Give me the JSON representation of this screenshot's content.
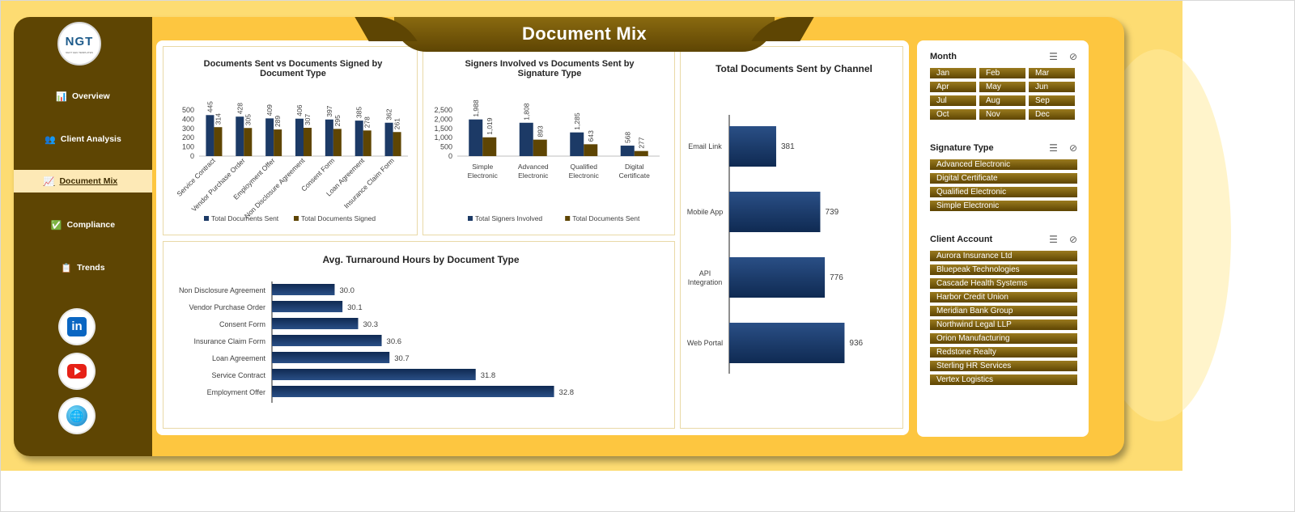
{
  "header": {
    "title": "Document Mix"
  },
  "logo": {
    "text": "NGT",
    "tagline": "NEXT GEN TEMPLATES"
  },
  "sidebar": {
    "items": [
      {
        "label": "Overview",
        "icon": "bar-chart-icon",
        "glyph": "📊"
      },
      {
        "label": "Client Analysis",
        "icon": "people-icon",
        "glyph": "👥"
      },
      {
        "label": "Document Mix",
        "icon": "line-chart-icon",
        "glyph": "📈",
        "active": true
      },
      {
        "label": "Compliance",
        "icon": "checkmark-icon",
        "glyph": "✅"
      },
      {
        "label": "Trends",
        "icon": "document-icon",
        "glyph": "📋"
      }
    ],
    "social": [
      {
        "name": "linkedin-icon",
        "glyph": "in"
      },
      {
        "name": "youtube-icon",
        "glyph": ""
      },
      {
        "name": "website-icon",
        "glyph": "🌐"
      }
    ]
  },
  "slicers": {
    "month": {
      "title": "Month",
      "options": [
        "Jan",
        "Feb",
        "Mar",
        "Apr",
        "May",
        "Jun",
        "Jul",
        "Aug",
        "Sep",
        "Oct",
        "Nov",
        "Dec"
      ]
    },
    "signature_type": {
      "title": "Signature Type",
      "options": [
        "Advanced Electronic",
        "Digital Certificate",
        "Qualified Electronic",
        "Simple Electronic"
      ]
    },
    "client_account": {
      "title": "Client Account",
      "options": [
        "Aurora Insurance Ltd",
        "Bluepeak Technologies",
        "Cascade Health Systems",
        "Harbor Credit Union",
        "Meridian Bank Group",
        "Northwind Legal LLP",
        "Orion Manufacturing",
        "Redstone Realty",
        "Sterling HR Services",
        "Vertex Logistics"
      ]
    }
  },
  "colors": {
    "navy": "#1c3a66",
    "brown": "#5e4503",
    "sidebar": "#5e4503",
    "frame": "#fdc640"
  },
  "chart_data": [
    {
      "id": "sent-vs-signed",
      "type": "bar",
      "title": "Documents Sent vs Documents Signed by Document Type",
      "categories": [
        "Service Contract",
        "Vendor Purchase Order",
        "Employment Offer",
        "Non Disclosure Agreement",
        "Consent Form",
        "Loan Agreement",
        "Insurance Claim Form"
      ],
      "series": [
        {
          "name": "Total Documents Sent",
          "values": [
            445,
            428,
            409,
            406,
            397,
            385,
            362
          ]
        },
        {
          "name": "Total Documents Signed",
          "values": [
            314,
            305,
            289,
            307,
            295,
            278,
            261
          ]
        }
      ],
      "ylim": [
        0,
        500
      ],
      "yticks": [
        "0",
        "100",
        "200",
        "300",
        "400",
        "500"
      ],
      "legend": "bottom",
      "grid": false
    },
    {
      "id": "signers-vs-sent",
      "type": "bar",
      "title": "Signers Involved vs Documents Sent by Signature Type",
      "categories": [
        [
          "Simple",
          "Electronic"
        ],
        [
          "Advanced",
          "Electronic"
        ],
        [
          "Qualified",
          "Electronic"
        ],
        [
          "Digital",
          "Certificate"
        ]
      ],
      "series": [
        {
          "name": "Total Signers Involved",
          "values": [
            1988,
            1808,
            1285,
            568
          ],
          "labels": [
            "1,988",
            "1,808",
            "1,285",
            "568"
          ]
        },
        {
          "name": "Total Documents Sent",
          "values": [
            1019,
            893,
            643,
            277
          ],
          "labels": [
            "1,019",
            "893",
            "643",
            "277"
          ]
        }
      ],
      "ylim": [
        0,
        2500
      ],
      "yticks": [
        "0",
        "500",
        "1,000",
        "1,500",
        "2,000",
        "2,500"
      ],
      "legend": "bottom",
      "grid": false
    },
    {
      "id": "turnaround",
      "type": "bar",
      "orientation": "horizontal",
      "title": "Avg. Turnaround Hours by Document Type",
      "categories": [
        "Non Disclosure Agreement",
        "Vendor Purchase Order",
        "Consent Form",
        "Insurance Claim Form",
        "Loan Agreement",
        "Service Contract",
        "Employment Offer"
      ],
      "values": [
        30.0,
        30.1,
        30.3,
        30.6,
        30.7,
        31.8,
        32.8
      ],
      "labels": [
        "30.0",
        "30.1",
        "30.3",
        "30.6",
        "30.7",
        "31.8",
        "32.8"
      ],
      "xlim": [
        29.2,
        33.6
      ],
      "grid": false
    },
    {
      "id": "by-channel",
      "type": "bar",
      "orientation": "horizontal",
      "title": "Total Documents Sent by Channel",
      "categories": [
        [
          "Email Link"
        ],
        [
          "Mobile App"
        ],
        [
          "API",
          "Integration"
        ],
        [
          "Web Portal"
        ]
      ],
      "values": [
        381,
        739,
        776,
        936
      ],
      "labels": [
        "381",
        "739",
        "776",
        "936"
      ],
      "xlim": [
        0,
        1150
      ],
      "grid": false
    }
  ]
}
